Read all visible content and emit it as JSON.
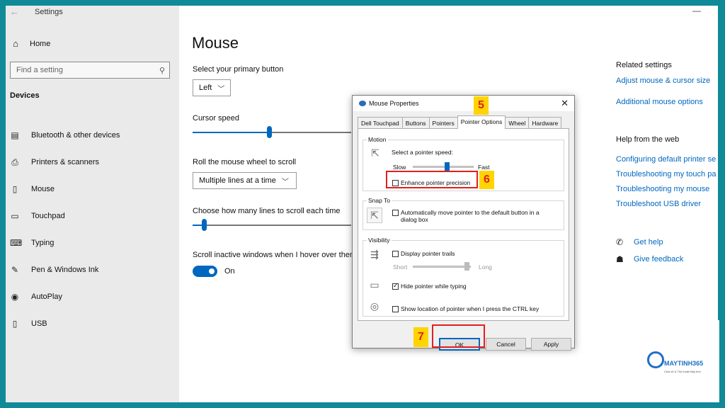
{
  "window": {
    "title": "Settings",
    "back_icon": "←",
    "minimize_icon": "—"
  },
  "sidebar": {
    "home_label": "Home",
    "search_placeholder": "Find a setting",
    "section_title": "Devices",
    "items": [
      {
        "label": "Bluetooth & other devices",
        "icon": "bluetooth-icon"
      },
      {
        "label": "Printers & scanners",
        "icon": "printer-icon"
      },
      {
        "label": "Mouse",
        "icon": "mouse-icon"
      },
      {
        "label": "Touchpad",
        "icon": "touchpad-icon"
      },
      {
        "label": "Typing",
        "icon": "keyboard-icon"
      },
      {
        "label": "Pen & Windows Ink",
        "icon": "pen-icon"
      },
      {
        "label": "AutoPlay",
        "icon": "autoplay-icon"
      },
      {
        "label": "USB",
        "icon": "usb-icon"
      }
    ]
  },
  "main": {
    "title": "Mouse",
    "primary_button_label": "Select your primary button",
    "primary_button_value": "Left",
    "cursor_speed_label": "Cursor speed",
    "cursor_speed_level": 0.48,
    "scroll_label": "Roll the mouse wheel to scroll",
    "scroll_value": "Multiple lines at a time",
    "lines_label": "Choose how many lines to scroll each time",
    "lines_level": 0.07,
    "inactive_label": "Scroll inactive windows when I hover over them",
    "inactive_value": "On"
  },
  "related": {
    "title": "Related settings",
    "links": [
      "Adjust mouse & cursor size",
      "Additional mouse options"
    ],
    "help_title": "Help from the web",
    "help_links": [
      "Configuring default printer se",
      "Troubleshooting my touch pa",
      "Troubleshooting my mouse",
      "Troubleshoot USB driver"
    ],
    "get_help": "Get help",
    "feedback": "Give feedback"
  },
  "dialog": {
    "title": "Mouse Properties",
    "tabs": [
      "Dell Touchpad",
      "Buttons",
      "Pointers",
      "Pointer Options",
      "Wheel",
      "Hardware"
    ],
    "active_tab": "Pointer Options",
    "motion_title": "Motion",
    "speed_label": "Select a pointer speed:",
    "slow": "Slow",
    "fast": "Fast",
    "speed_level": 0.55,
    "enhance_label": "Enhance pointer precision",
    "enhance_checked": false,
    "snap_title": "Snap To",
    "snap_label_1": "Automatically move pointer to the default button in a",
    "snap_label_2": "dialog box",
    "visibility_title": "Visibility",
    "trails_label": "Display pointer trails",
    "short": "Short",
    "long": "Long",
    "hide_label": "Hide pointer while typing",
    "hide_checked": true,
    "ctrl_label": "Show location of pointer when I press the CTRL key",
    "ok": "OK",
    "cancel": "Cancel",
    "apply": "Apply"
  },
  "annotations": {
    "step5": "5",
    "step6": "6",
    "step7": "7"
  },
  "logo": {
    "name": "MAYTINH365",
    "tagline": "Chia sẻ & Thủ thuật Máy tính"
  },
  "colors": {
    "accent": "#0067c0",
    "annotation_red": "#e02020",
    "annotation_yellow": "#ffd400",
    "frame": "#0f8a96"
  }
}
